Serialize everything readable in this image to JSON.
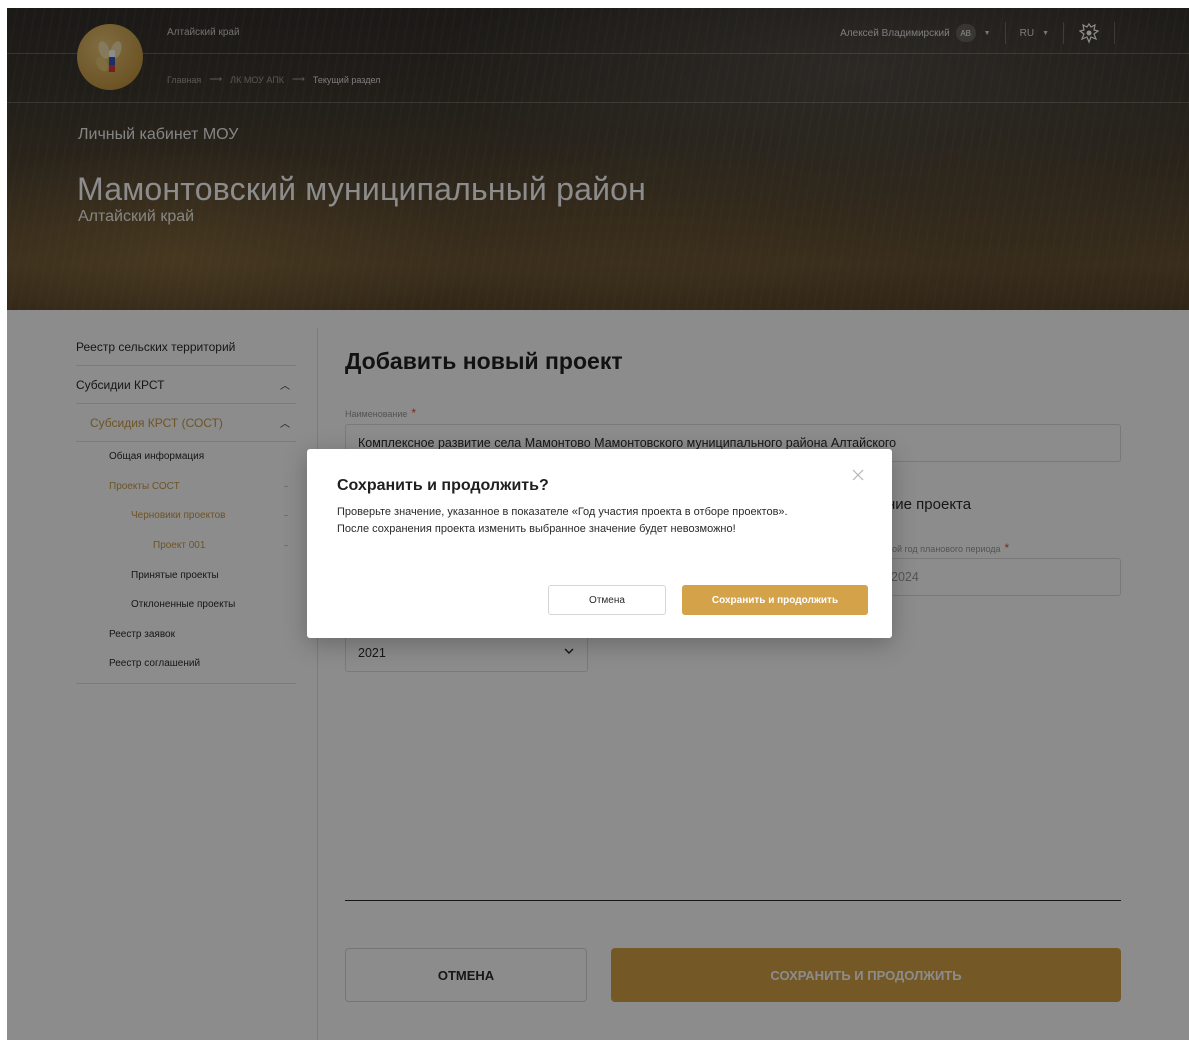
{
  "header": {
    "region": "Алтайский край",
    "breadcrumb": [
      "Главная",
      "ЛК МОУ АПК",
      "Текущий раздел"
    ],
    "user_name": "Алексей Владимирский",
    "user_initials": "АВ",
    "language": "RU",
    "cabinet_title": "Личный кабинет МОУ",
    "district": "Мамонтовский муниципальный район",
    "district_region": "Алтайский край"
  },
  "sidebar": {
    "registry_rural": "Реестр сельских территорий",
    "subsidies": "Субсидии КРСТ",
    "subsidy_sost": "Субсидия КРСТ (СОСТ)",
    "general_info": "Общая информация",
    "projects_sost": "Проекты СОСТ",
    "drafts": "Черновики проектов",
    "project_001": "Проект 001",
    "accepted": "Принятые проекты",
    "rejected": "Отклоненные проекты",
    "applications": "Реестр заявок",
    "agreements": "Реестр соглашений"
  },
  "form": {
    "title": "Добавить новый проект",
    "name_label": "Наименование",
    "required_mark": "*",
    "name_value": "Комплексное развитие села Мамонтово Мамонтовского муниципального района Алтайского",
    "section_partial": "ние проекта",
    "second_year_label_partial": "рой год планового периода",
    "second_year_value": "2024",
    "participation_year": "2021"
  },
  "footer_buttons": {
    "cancel": "ОТМЕНА",
    "save": "СОХРАНИТЬ И ПРОДОЛЖИТЬ"
  },
  "modal": {
    "title": "Сохранить и продолжить?",
    "text": "Проверьте значение, указанное в показателе «Год участия проекта в отборе проектов». После сохранения проекта изменить выбранное значение будет невозможно!",
    "cancel": "Отмена",
    "confirm": "Сохранить и продолжить"
  },
  "colors": {
    "accent": "#d4a248",
    "active_text": "#c79a45",
    "required": "#e34b3a"
  },
  "icons": {
    "logo": "wheat-logo-icon",
    "emblem": "coat-of-arms-icon",
    "close": "close-icon",
    "chevron": "chevron-down-icon"
  }
}
